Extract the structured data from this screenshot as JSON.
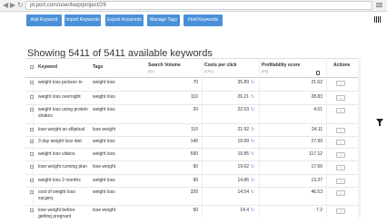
{
  "browser": {
    "url": "pt.port.com/user/kwp/project/29"
  },
  "toolbar": {
    "add_keyword": "Add Keyword",
    "import_keywords": "Import Keywords",
    "export_keywords": "Export Keywords",
    "manage_tags": "Manage Tags",
    "find_keywords": "Find Keywords"
  },
  "heading": "Showing 5411 of 5411 available keywords",
  "columns": {
    "keyword": "Keyword",
    "tags": "Tags",
    "search_volume": "Search Volume",
    "search_volume_sub": "(SV)",
    "cost_per_click": "Costs per click",
    "cost_per_click_sub": "(CPC)",
    "profitability": "Profitability score",
    "profitability_sub": "(PS)",
    "actions": "Actions"
  },
  "rows": [
    {
      "keyword": "weight loss jackson tn",
      "tag": "weight loss",
      "sv": "70",
      "cpc": "35.89",
      "ps": "21.62"
    },
    {
      "keyword": "weight loss overnight",
      "tag": "weight loss",
      "sv": "110",
      "cpc": "26.21",
      "ps": "28.83"
    },
    {
      "keyword": "weight loss using protein shakes",
      "tag": "weight loss",
      "sv": "20",
      "cpc": "22.53",
      "ps": "4.51"
    },
    {
      "keyword": "lose weight an elliptical",
      "tag": "lose weight",
      "sv": "110",
      "cpc": "21.92",
      "ps": "24.11"
    },
    {
      "keyword": "3 day weight loss diet",
      "tag": "weight loss",
      "sv": "140",
      "cpc": "19.99",
      "ps": "27.99"
    },
    {
      "keyword": "weight loss videos",
      "tag": "weight loss",
      "sv": "590",
      "cpc": "19.85",
      "ps": "117.12"
    },
    {
      "keyword": "lose weight running plan",
      "tag": "lose weight",
      "sv": "90",
      "cpc": "19.62",
      "ps": "17.66"
    },
    {
      "keyword": "weight loss 2 months",
      "tag": "weight loss",
      "sv": "90",
      "cpc": "14.86",
      "ps": "13.37"
    },
    {
      "keyword": "cost of weight loss surgery",
      "tag": "weight loss",
      "sv": "320",
      "cpc": "14.54",
      "ps": "46.53"
    },
    {
      "keyword": "lose weight before getting pregnant",
      "tag": "lose weight",
      "sv": "50",
      "cpc": "14.4",
      "ps": "7.2"
    }
  ],
  "actions_label": "...",
  "icons": {
    "refresh": "refresh-icon",
    "grid": "grid-view-icon",
    "filter": "filter-icon"
  },
  "colors": {
    "accent": "#4a90d9"
  }
}
